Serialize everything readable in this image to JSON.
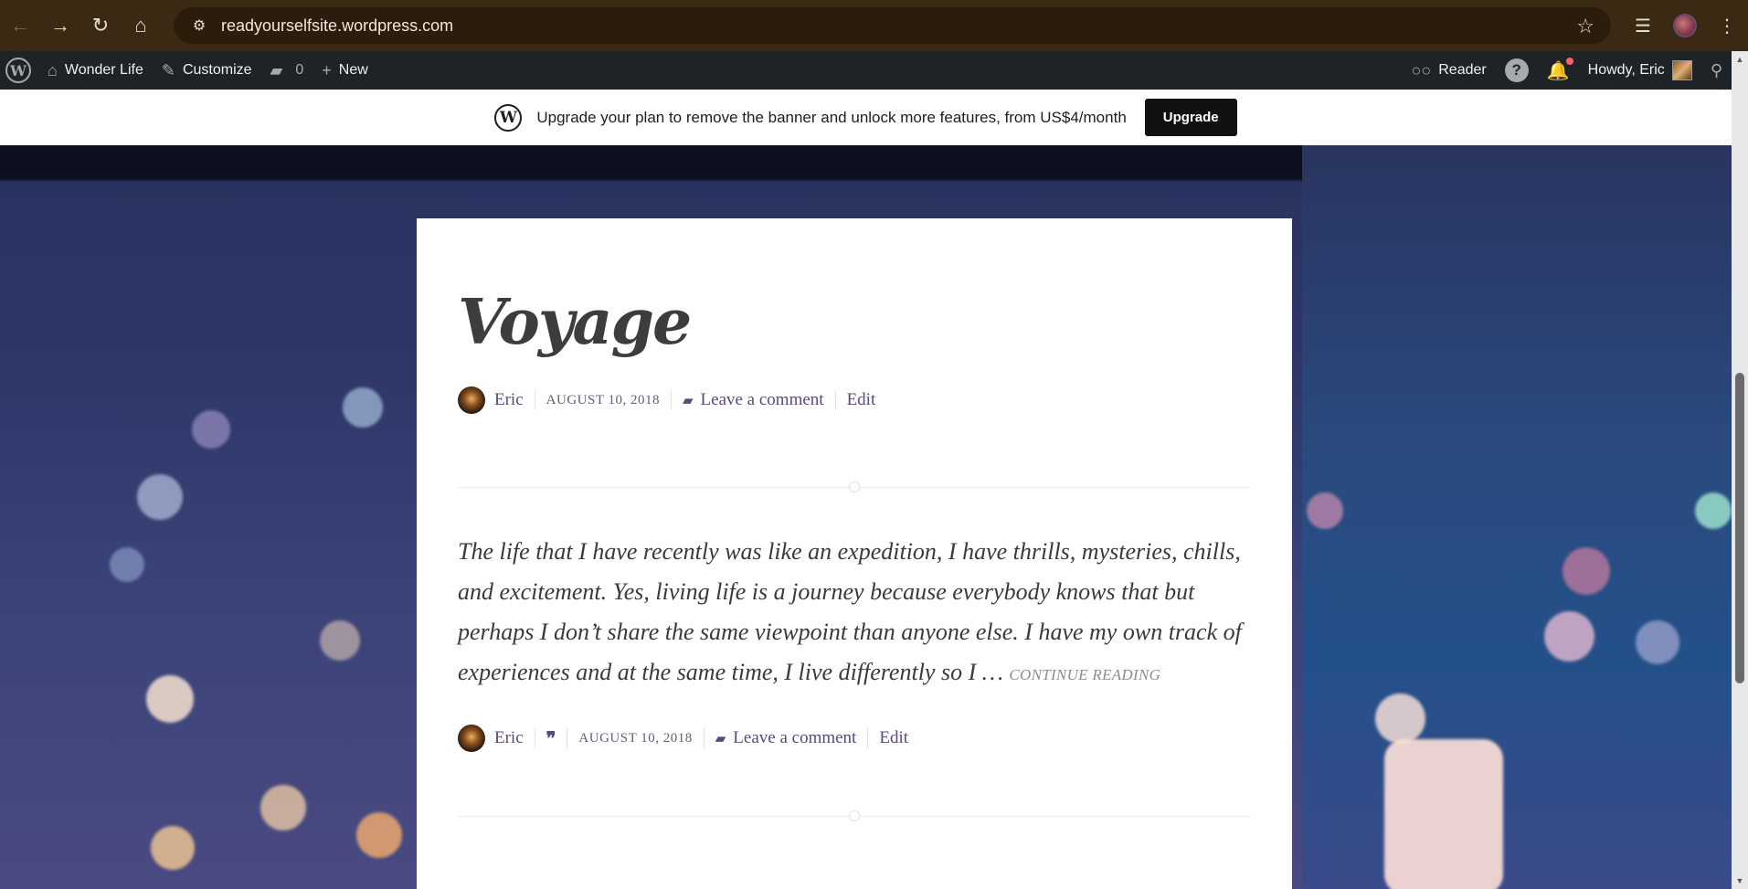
{
  "browser": {
    "url": "readyourselfsite.wordpress.com",
    "icons": [
      "back-icon",
      "forward-icon",
      "reload-icon",
      "home-icon",
      "site-info-icon",
      "bookmark-star-icon",
      "reading-list-icon",
      "profile-avatar",
      "more-menu-icon"
    ]
  },
  "adminbar": {
    "site_name": "Wonder Life",
    "customize": "Customize",
    "comments_count": "0",
    "new": "New",
    "reader": "Reader",
    "howdy": "Howdy, Eric"
  },
  "banner": {
    "text": "Upgrade your plan to remove the banner and unlock more features, from US$4/month",
    "button": "Upgrade"
  },
  "post": {
    "title": "Voyage",
    "author": "Eric",
    "date": "AUGUST 10, 2018",
    "comment_link": "Leave a comment",
    "edit_link": "Edit",
    "excerpt": "The life that I have recently was like an expedition, I have thrills, mysteries, chills, and excitement. Yes, living life is a journey because everybody knows that but perhaps I don’t share the same viewpoint than anyone else. I have my own track of experiences and at the same time, I live differently so I …",
    "continue_reading": "CONTINUE READING",
    "quote_glyph": "❞"
  },
  "colors": {
    "chrome_bg": "#3a2a14",
    "adminbar_bg": "#1d2327",
    "link": "#5a4a7a",
    "card_bg": "#ffffff"
  }
}
